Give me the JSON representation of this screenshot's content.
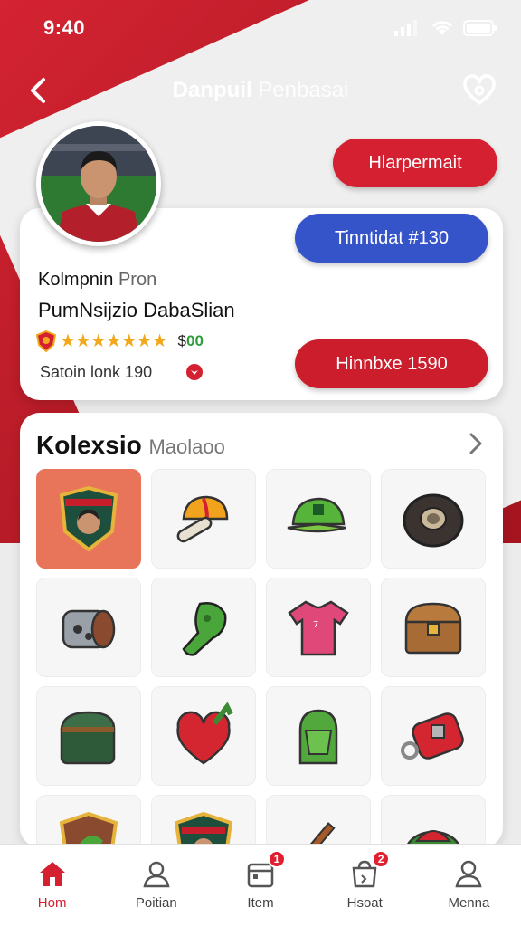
{
  "status_bar": {
    "time": "9:40"
  },
  "header": {
    "title_bold": "Danpuil",
    "title_rest": "Penbasai"
  },
  "buttons": {
    "top": "Hlarpermait",
    "blue": "Tinntidat #130",
    "red": "Hinnbxe 1590"
  },
  "profile": {
    "label": "Kolmpnin",
    "label_suffix": "Pron",
    "name": "PumNsijzio DabaSlian",
    "stars": "★★★★★★★",
    "price_prefix": "$",
    "price_value": "00",
    "rank_text": "Satoin lonk 190"
  },
  "collection": {
    "title": "Kolexsio",
    "title_suffix": "Maolaoo",
    "items": [
      {
        "name": "badge-shield-icon",
        "active": true
      },
      {
        "name": "cap-bat-icon"
      },
      {
        "name": "green-cap-icon"
      },
      {
        "name": "tire-icon"
      },
      {
        "name": "brown-wheel-icon"
      },
      {
        "name": "green-horn-icon"
      },
      {
        "name": "pink-jersey-icon"
      },
      {
        "name": "treasure-chest-icon"
      },
      {
        "name": "green-chest-icon"
      },
      {
        "name": "red-heart-icon"
      },
      {
        "name": "green-helmet-icon"
      },
      {
        "name": "red-lock-icon"
      },
      {
        "name": "shield-leaf-icon"
      },
      {
        "name": "shield-portrait-icon"
      },
      {
        "name": "red-guitar-icon"
      },
      {
        "name": "green-melon-icon"
      }
    ]
  },
  "tabbar": {
    "items": [
      {
        "label": "Hom",
        "active": true
      },
      {
        "label": "Poitian"
      },
      {
        "label": "Item",
        "badge": "1"
      },
      {
        "label": "Hsoat",
        "badge": "2"
      },
      {
        "label": "Menna"
      }
    ]
  },
  "colors": {
    "brand_red": "#d42030",
    "blue": "#3654c9",
    "active_tile": "#e8745a"
  }
}
